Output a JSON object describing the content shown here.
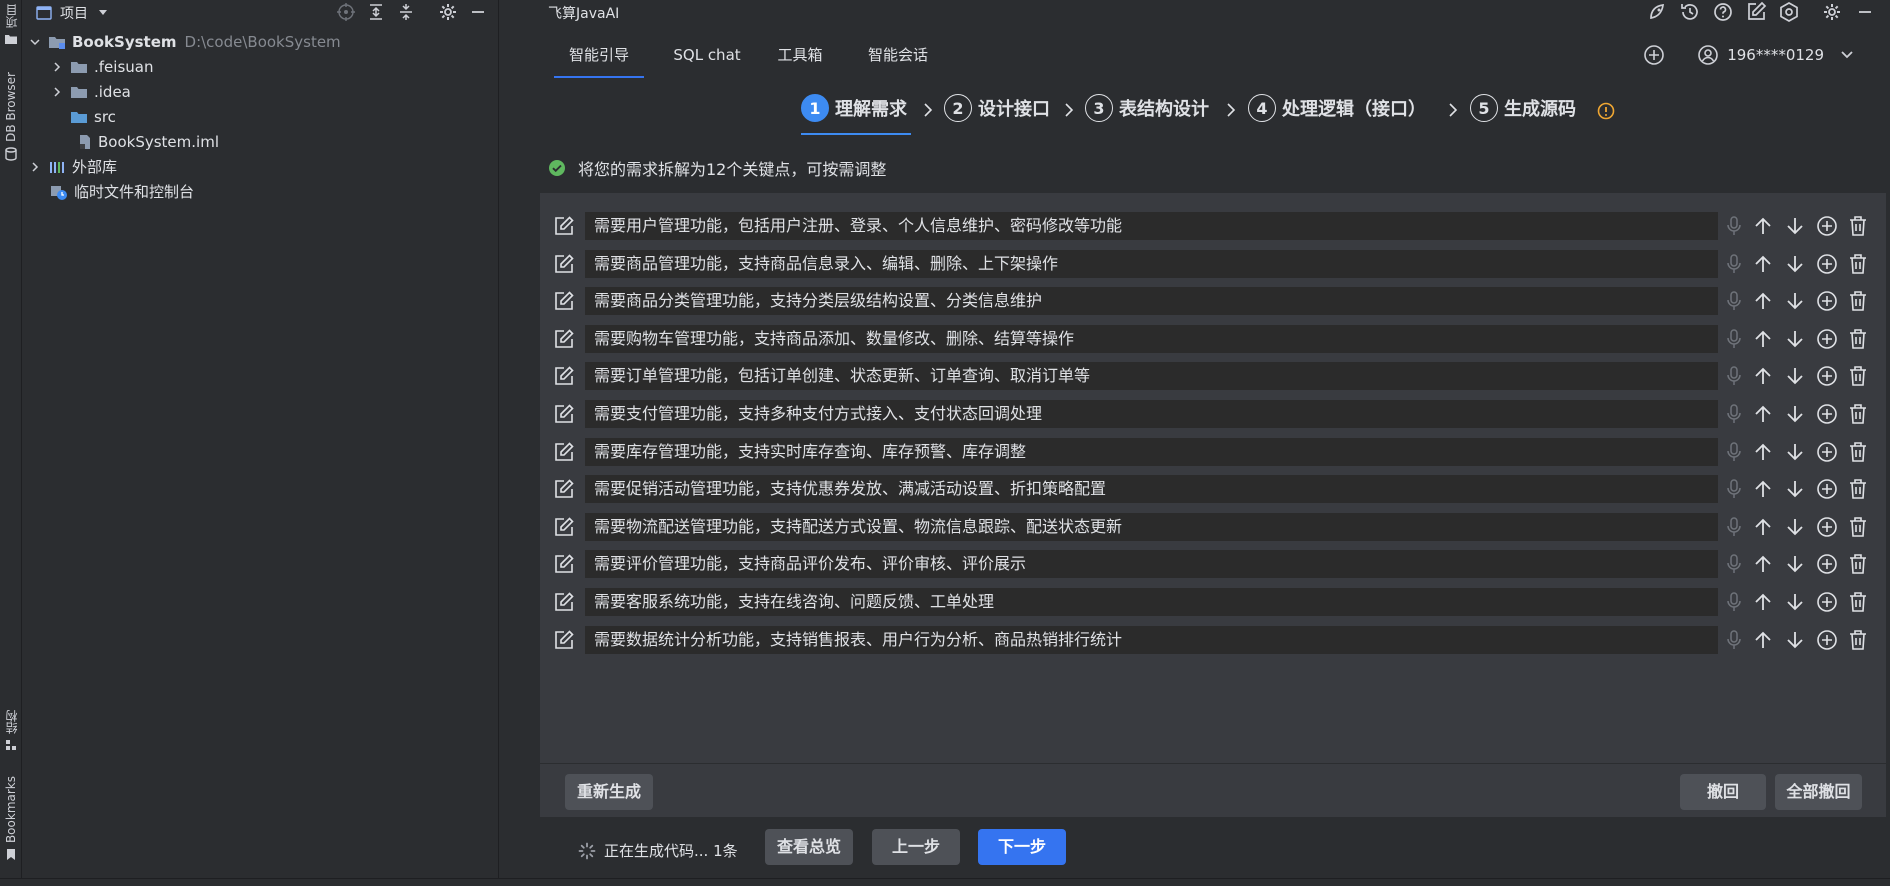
{
  "strip": {
    "project_tab": "项目",
    "db_browser_tab": "DB Browser",
    "structure_tab": "结构",
    "bookmarks_tab": "Bookmarks"
  },
  "project": {
    "title": "项目",
    "tree": [
      {
        "label": "BookSystem",
        "path": "D:\\code\\BookSystem"
      },
      {
        "label": ".feisuan"
      },
      {
        "label": ".idea"
      },
      {
        "label": "src"
      },
      {
        "label": "BookSystem.iml"
      },
      {
        "label": "外部库"
      },
      {
        "label": "临时文件和控制台"
      }
    ]
  },
  "plugin": {
    "title": "飞算JavaAI",
    "tabs": [
      "智能引导",
      "SQL chat",
      "工具箱",
      "智能会话"
    ],
    "active_tab": 0,
    "user": "196****0129",
    "steps": [
      {
        "num": "1",
        "label": "理解需求"
      },
      {
        "num": "2",
        "label": "设计接口"
      },
      {
        "num": "3",
        "label": "表结构设计"
      },
      {
        "num": "4",
        "label": "处理逻辑（接口）"
      },
      {
        "num": "5",
        "label": "生成源码"
      }
    ],
    "info_text": "将您的需求拆解为12个关键点，可按需调整",
    "requirements": [
      "需要用户管理功能，包括用户注册、登录、个人信息维护、密码修改等功能",
      "需要商品管理功能，支持商品信息录入、编辑、删除、上下架操作",
      "需要商品分类管理功能，支持分类层级结构设置、分类信息维护",
      "需要购物车管理功能，支持商品添加、数量修改、删除、结算等操作",
      "需要订单管理功能，包括订单创建、状态更新、订单查询、取消订单等",
      "需要支付管理功能，支持多种支付方式接入、支付状态回调处理",
      "需要库存管理功能，支持实时库存查询、库存预警、库存调整",
      "需要促销活动管理功能，支持优惠券发放、满减活动设置、折扣策略配置",
      "需要物流配送管理功能，支持配送方式设置、物流信息跟踪、配送状态更新",
      "需要评价管理功能，支持商品评价发布、评价审核、评价展示",
      "需要客服系统功能，支持在线咨询、问题反馈、工单处理",
      "需要数据统计分析功能，支持销售报表、用户行为分析、商品热销排行统计"
    ],
    "regenerate": "重新生成",
    "undo": "撤回",
    "undo_all": "全部撤回",
    "status": "正在生成代码... 1条",
    "overview": "查看总览",
    "prev": "上一步",
    "next": "下一步"
  },
  "colors": {
    "accent": "#3574f0",
    "success": "#5fb85f",
    "warning": "#f0a732"
  }
}
